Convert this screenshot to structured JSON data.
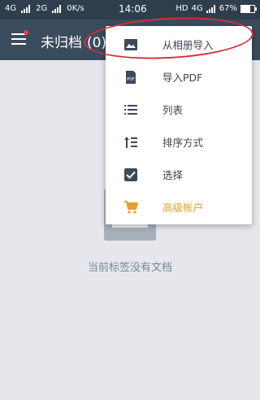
{
  "status_bar": {
    "left": [
      "4G",
      "2G",
      "0K/s"
    ],
    "time": "14:06",
    "right_hd": "HD",
    "right_net": "4G",
    "battery": "67%"
  },
  "toolbar": {
    "title": "未归档",
    "count": "(0)"
  },
  "empty_state": {
    "message": "当前标签没有文档"
  },
  "menu": {
    "items": [
      {
        "label": "从相册导入",
        "icon": "image-icon"
      },
      {
        "label": "导入PDF",
        "icon": "pdf-icon"
      },
      {
        "label": "列表",
        "icon": "list-icon"
      },
      {
        "label": "排序方式",
        "icon": "sort-icon"
      },
      {
        "label": "选择",
        "icon": "checkbox-icon"
      },
      {
        "label": "高级帐户",
        "icon": "cart-icon"
      }
    ]
  },
  "colors": {
    "toolbar": "#3a4b5c",
    "status_bar": "#2f3e4d",
    "premium": "#e1a12b",
    "annotation": "#d0323a"
  }
}
